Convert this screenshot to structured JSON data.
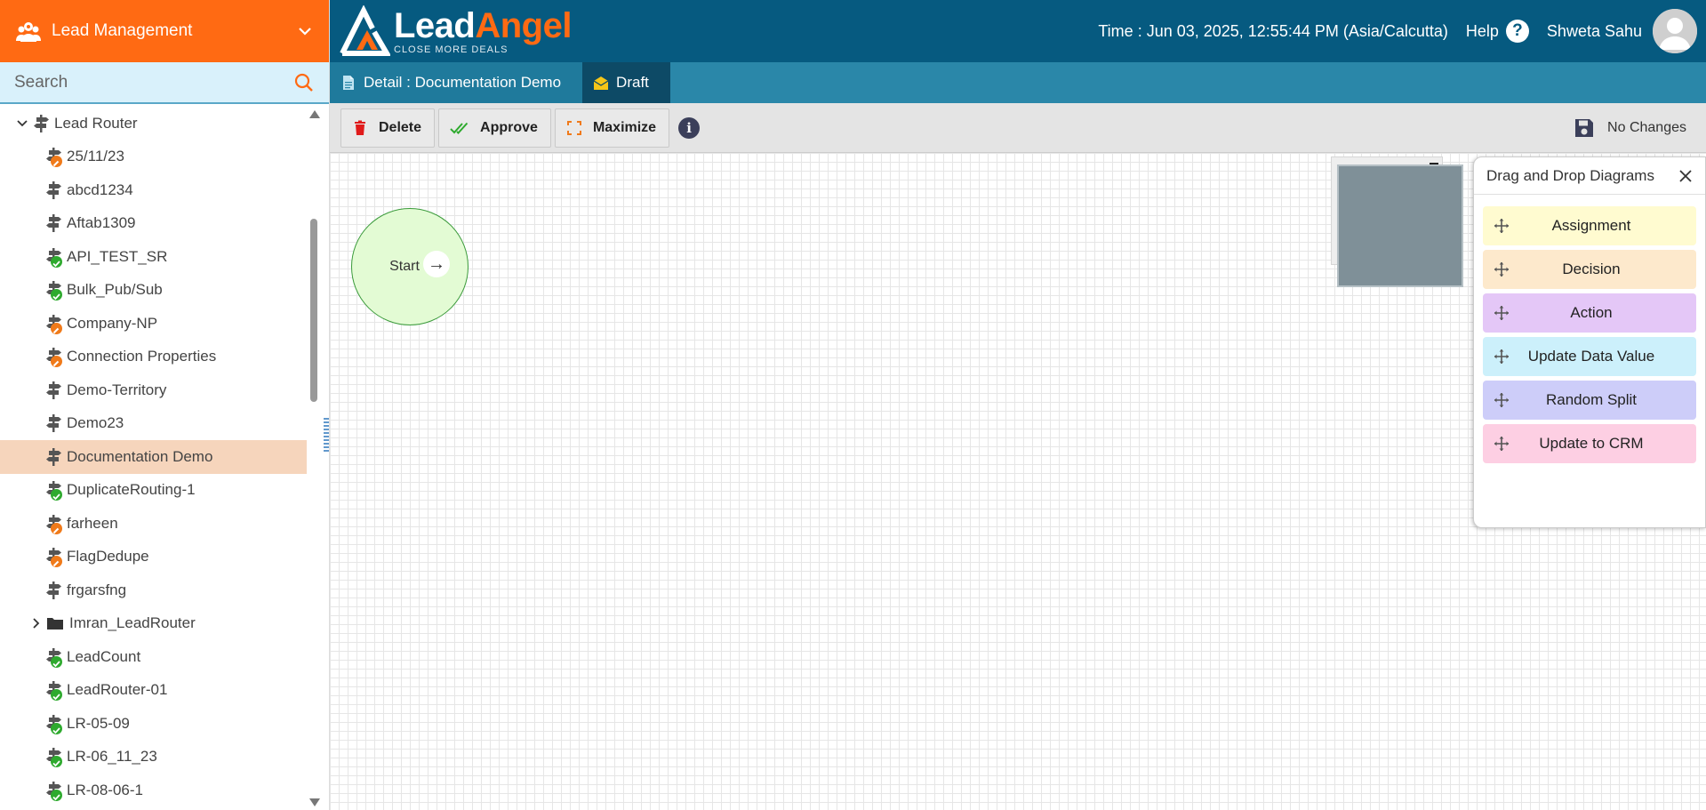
{
  "app": {
    "title": "Lead Management"
  },
  "search": {
    "placeholder": "Search"
  },
  "logo": {
    "name_part1": "Lead",
    "name_part2": "Angel",
    "tagline": "CLOSE MORE DEALS"
  },
  "header": {
    "time": "Time : Jun 03, 2025, 12:55:44 PM (Asia/Calcutta)",
    "help": "Help",
    "help_glyph": "?",
    "user": "Shweta Sahu"
  },
  "tabs": {
    "detail": "Detail : Documentation Demo",
    "draft": "Draft"
  },
  "toolbar": {
    "delete": "Delete",
    "approve": "Approve",
    "maximize": "Maximize",
    "info_glyph": "i",
    "save_status": "No Changes"
  },
  "tree": {
    "root": "Lead Router",
    "items": [
      {
        "label": "25/11/23",
        "status": "warn"
      },
      {
        "label": "abcd1234",
        "status": "none"
      },
      {
        "label": "Aftab1309",
        "status": "none"
      },
      {
        "label": "API_TEST_SR",
        "status": "ok"
      },
      {
        "label": "Bulk_Pub/Sub",
        "status": "ok"
      },
      {
        "label": "Company-NP",
        "status": "warn"
      },
      {
        "label": "Connection Properties",
        "status": "warn"
      },
      {
        "label": "Demo-Territory",
        "status": "none"
      },
      {
        "label": "Demo23",
        "status": "none"
      },
      {
        "label": "Documentation Demo",
        "status": "none",
        "active": true
      },
      {
        "label": "DuplicateRouting-1",
        "status": "ok"
      },
      {
        "label": "farheen",
        "status": "warn"
      },
      {
        "label": "FlagDedupe",
        "status": "warn"
      },
      {
        "label": "frgarsfng",
        "status": "none"
      },
      {
        "label": "Imran_LeadRouter",
        "status": "folder"
      },
      {
        "label": "LeadCount",
        "status": "ok"
      },
      {
        "label": "LeadRouter-01",
        "status": "ok"
      },
      {
        "label": "LR-05-09",
        "status": "ok"
      },
      {
        "label": "LR-06_11_23",
        "status": "ok"
      },
      {
        "label": "LR-08-06-1",
        "status": "ok"
      }
    ]
  },
  "canvas": {
    "start_label": "Start",
    "start_arrow": "→"
  },
  "palette": {
    "title": "Drag and Drop Diagrams",
    "items": [
      {
        "label": "Assignment",
        "color": "#fffbd0"
      },
      {
        "label": "Decision",
        "color": "#fde9cc"
      },
      {
        "label": "Action",
        "color": "#e4c7f7"
      },
      {
        "label": "Update Data Value",
        "color": "#ccf0fb"
      },
      {
        "label": "Random Split",
        "color": "#cdcdf9"
      },
      {
        "label": "Update to CRM",
        "color": "#fdcfe3"
      }
    ]
  },
  "colors": {
    "brand_orange": "#ff6a13",
    "header_blue": "#065a80",
    "tab_blue": "#2a87a9",
    "active_row": "#f6d5bc",
    "status_ok": "#2eaa2e",
    "status_warn": "#f07a1a"
  }
}
